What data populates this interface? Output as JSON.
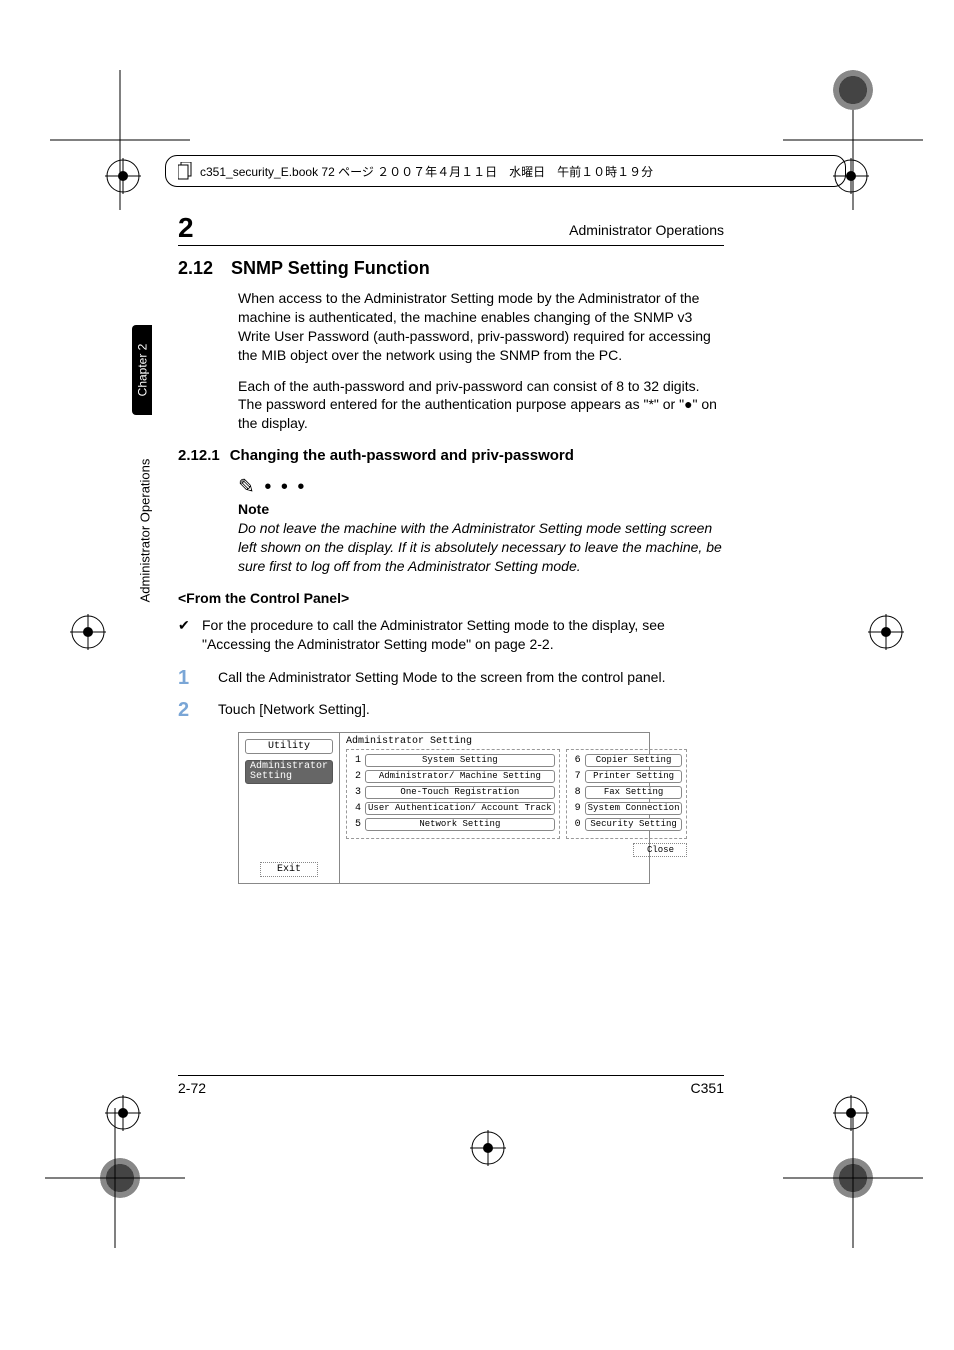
{
  "print_header": "c351_security_E.book  72 ページ  ２００７年４月１１日　水曜日　午前１０時１９分",
  "chapter_num": "2",
  "header_right": "Administrator Operations",
  "side_tab": "Chapter 2",
  "side_label": "Administrator Operations",
  "section": {
    "num": "2.12",
    "title": "SNMP Setting Function"
  },
  "para1": "When access to the Administrator Setting mode by the Administrator of the machine is authenticated, the machine enables changing of the SNMP v3 Write User Password (auth-password, priv-password) required for accessing the MIB object over the network using the SNMP from the PC.",
  "para2": "Each of the auth-password and priv-password can consist of 8 to 32 digits. The password entered for the authentication purpose appears as \"*\" or \"●\" on the display.",
  "subsection": {
    "num": "2.12.1",
    "title": "Changing the auth-password and priv-password"
  },
  "note_label": "Note",
  "note_body": "Do not leave the machine with the Administrator Setting mode setting screen left shown on the display. If it is absolutely necessary to leave the machine, be sure first to log off from the Administrator Setting mode.",
  "from_panel": "<From the Control Panel>",
  "check_text": "For the procedure to call the Administrator Setting mode to the display, see \"Accessing the Administrator Setting mode\" on page 2-2.",
  "steps": [
    {
      "n": "1",
      "t": "Call the Administrator Setting Mode to the screen from the control panel."
    },
    {
      "n": "2",
      "t": "Touch [Network Setting]."
    }
  ],
  "fig": {
    "utility": "Utility",
    "admin_tab": "Administrator Setting",
    "exit": "Exit",
    "title": "Administrator Setting",
    "left_items": [
      {
        "n": "1",
        "label": "System Setting"
      },
      {
        "n": "2",
        "label": "Administrator/ Machine Setting"
      },
      {
        "n": "3",
        "label": "One-Touch Registration"
      },
      {
        "n": "4",
        "label": "User Authentication/ Account Track"
      },
      {
        "n": "5",
        "label": "Network Setting"
      }
    ],
    "right_items": [
      {
        "n": "6",
        "label": "Copier Setting"
      },
      {
        "n": "7",
        "label": "Printer Setting"
      },
      {
        "n": "8",
        "label": "Fax Setting"
      },
      {
        "n": "9",
        "label": "System Connection"
      },
      {
        "n": "0",
        "label": "Security Setting"
      }
    ],
    "close": "Close"
  },
  "footer": {
    "left": "2-72",
    "right": "C351"
  }
}
